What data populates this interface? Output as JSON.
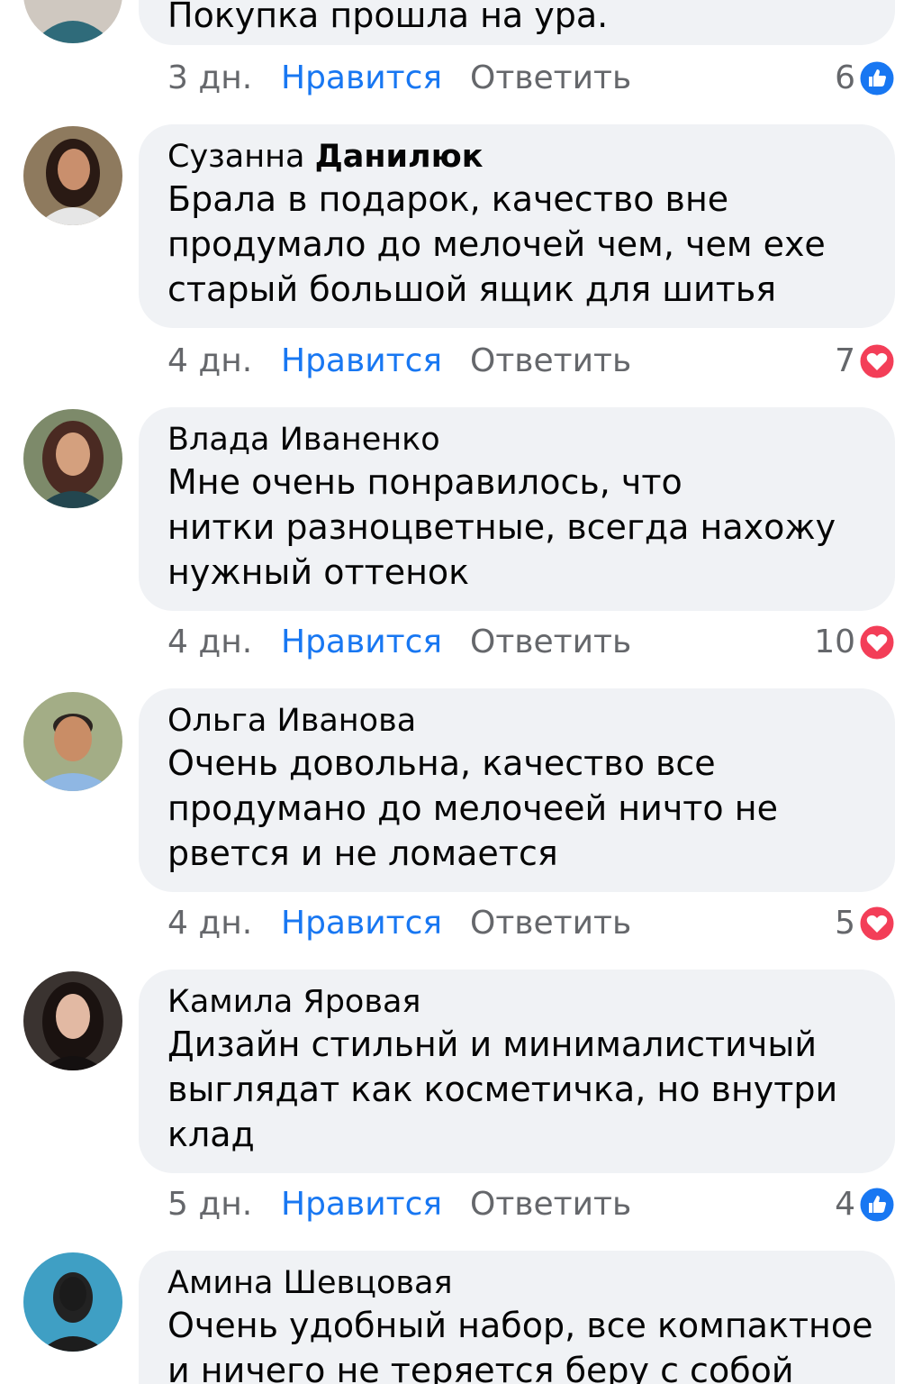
{
  "comments": [
    {
      "author_first": "",
      "author_last": "",
      "lines": [
        "Покупка прошла на ура."
      ],
      "time": "3 дн.",
      "like_label": "Нравится",
      "reply_label": "Ответить",
      "reaction_count": "6",
      "reaction_icon": "like-icon"
    },
    {
      "author_first": "Сузанна ",
      "author_last": "Данилюк",
      "lines": [
        "Брала в подарок, качество вне",
        "продумало до мелочей чем, чем‌ ехе",
        "старый большой ящик для шитья"
      ],
      "time": "4 дн.",
      "like_label": "Нравится",
      "reply_label": "Ответить",
      "reaction_count": "7",
      "reaction_icon": "heart-icon"
    },
    {
      "author_first": "Влада ",
      "author_last": "Иваненко",
      "lines": [
        "Мне очень понравилось, что",
        "нитки разноцветные, всегда нахожу",
        "нужный оттенок"
      ],
      "time": "4 дн.",
      "like_label": "Нравится",
      "reply_label": "Ответить",
      "reaction_count": "10",
      "reaction_icon": "heart-icon"
    },
    {
      "author_first": "Ольга Иванова",
      "author_last": "",
      "lines": [
        "Очень довольна, качество все",
        "продумано до мелочеей ничто не",
        "рвется и не ломается"
      ],
      "time": "4 дн.",
      "like_label": "Нравится",
      "reply_label": "Ответить",
      "reaction_count": "5",
      "reaction_icon": "heart-icon"
    },
    {
      "author_first": "Камила Яровая",
      "author_last": "",
      "lines": [
        "Дизайн стильнй и минималистичый",
        "выглядат как косметичка, но внутри",
        "клад"
      ],
      "time": "5 дн.",
      "like_label": "Нравится",
      "reply_label": "Ответить",
      "reaction_count": "4",
      "reaction_icon": "like-icon"
    },
    {
      "author_first": "Амина Шевцовая",
      "author_last": "",
      "lines": [
        "Очень удобный набор, все компактное",
        "и ничего не теряется беру с собой"
      ],
      "time": "",
      "like_label": "",
      "reply_label": "",
      "reaction_count": "",
      "reaction_icon": ""
    }
  ],
  "colors": {
    "bubble_bg": "#f0f2f5",
    "link_blue": "#1877f2",
    "meta_gray": "#65676b",
    "heart_red": "#f33e58",
    "like_blue": "#1877f2"
  }
}
